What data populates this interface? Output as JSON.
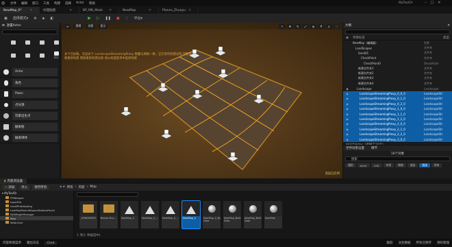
{
  "menu": {
    "items": [
      "文件",
      "编辑",
      "窗口",
      "工具",
      "构建",
      "选择",
      "Actor",
      "帮助"
    ],
    "project": "MyToolOr"
  },
  "tabs": [
    {
      "label": "NewMap_0*"
    },
    {
      "label": "纹理贴图"
    },
    {
      "label": "BP_MB_Mask"
    },
    {
      "label": "NewMap"
    },
    {
      "label": "Planes_Zhuayu"
    }
  ],
  "toolbar": {
    "mode": "选择模式",
    "platform": "平台"
  },
  "place_actor": {
    "title": "放置Actor",
    "label": "基础",
    "items": [
      "Actor",
      "角色",
      "Pawn",
      "点光源",
      "玩家出生点",
      "触发框",
      "触发球体"
    ]
  },
  "viewport": {
    "chips": [
      "透视",
      "光照",
      "显示"
    ],
    "message": "关卡已加载，流送关卡 LandscapeStreamingProxy 数量与网格一致，正在等待构建光照 可能需要重新构建 需要重新构建光照 请从构建菜单中选择构建",
    "status": "流送已启用"
  },
  "outliner": {
    "title": "大纲",
    "columns": {
      "label": "项目标签",
      "type": "类型"
    },
    "rows": [
      {
        "name": "NewMap（编辑器）",
        "type": "世界"
      },
      {
        "name": "LandScapes",
        "type": "文件夹"
      },
      {
        "name": "Sand01",
        "type": "文件夹"
      },
      {
        "name": "CheckPoint",
        "type": "文件夹"
      },
      {
        "name": "CheckPoint0",
        "type": "DecalActor"
      },
      {
        "name": "新建文件夹1",
        "type": "文件夹"
      },
      {
        "name": "新建文件夹2",
        "type": "文件夹"
      },
      {
        "name": "新建文件夹3",
        "type": "文件夹"
      },
      {
        "name": "新建文件夹4",
        "type": "文件夹"
      },
      {
        "name": "Landscape",
        "type": "Landscape"
      },
      {
        "name": "LandscapeStreamingProxy_0_0_0",
        "type": "LandscapeStr"
      },
      {
        "name": "LandscapeStreamingProxy_0_1_0",
        "type": "LandscapeStr"
      },
      {
        "name": "LandscapeStreamingProxy_0_2_0",
        "type": "LandscapeStr"
      },
      {
        "name": "LandscapeStreamingProxy_1_0_0",
        "type": "LandscapeStr"
      },
      {
        "name": "LandscapeStreamingProxy_1_1_0",
        "type": "LandscapeStr"
      },
      {
        "name": "LandscapeStreamingProxy_1_2_0",
        "type": "LandscapeStr"
      },
      {
        "name": "LandscapeStreamingProxy_2_0_0",
        "type": "LandscapeStr"
      },
      {
        "name": "LandscapeStreamingProxy_2_1_0",
        "type": "LandscapeStr"
      },
      {
        "name": "LandscapeStreamingProxy_2_2_0",
        "type": "LandscapeStr"
      },
      {
        "name": "LandscapeStreamingProxy_3_0_0",
        "type": "LandscapeStr"
      }
    ],
    "status": "443个Actor（选择了16个）"
  },
  "details": {
    "tabs": [
      "世界场景设置",
      "细节"
    ],
    "selected": "16个对象",
    "search": "搜索",
    "filters": [
      "通用",
      "Actor",
      "LOD",
      "杂项",
      "物理",
      "渲染",
      "流送",
      "所有"
    ],
    "active_filter": "流送"
  },
  "content_browser": {
    "tab": "内容浏览器",
    "add": "添加",
    "import": "导入",
    "save": "保存所有",
    "path": [
      "所有",
      "内容",
      "Map"
    ],
    "tree_title": "MyToolOr",
    "tree": [
      "FPWeapon",
      "InputFile",
      "LevelPrototyping",
      "LowPolyModuleSpaceStationPack2",
      "MAIMagicManager",
      "Map",
      "MatInCarr"
    ],
    "selected_tree": "Map",
    "assets": [
      {
        "name": "_GENERATED",
        "kind": "folder"
      },
      {
        "name": "Biome Stru...",
        "kind": "folder"
      },
      {
        "name": "NewMap_0",
        "kind": "map"
      },
      {
        "name": "NewMap_0_...",
        "kind": "map"
      },
      {
        "name": "NewMap_0_...",
        "kind": "map"
      },
      {
        "name": "NewMap_0",
        "kind": "map",
        "selected": true
      },
      {
        "name": "NewMap_0_Built Data",
        "kind": "ball"
      },
      {
        "name": "NewMap_Built Data",
        "kind": "ball"
      },
      {
        "name": "NewMap_Built Data",
        "kind": "ball"
      },
      {
        "name": "NewMap",
        "kind": "ball"
      }
    ],
    "count": "1 项(1 项被选中)"
  },
  "statusbar": {
    "items": [
      "内容侧滑菜单",
      "输出日志",
      "Cmd"
    ],
    "right": [
      "源码管理",
      "跟踪",
      "派生数据",
      "所有已保存"
    ]
  }
}
